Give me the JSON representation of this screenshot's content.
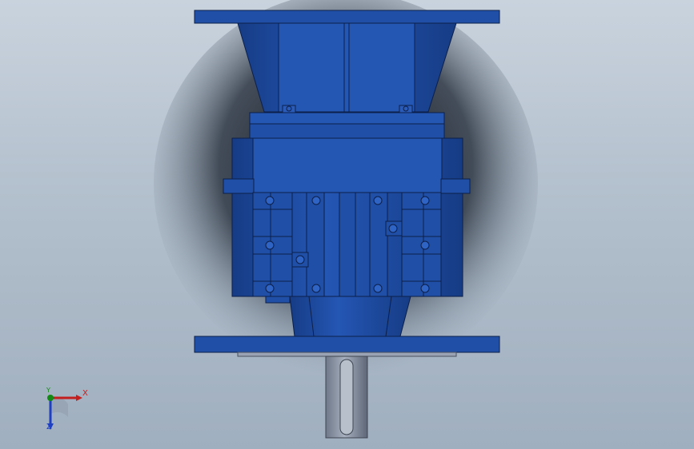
{
  "viewport": {
    "background_top": "#c9d3de",
    "background_bottom": "#a0afbf"
  },
  "model": {
    "body_color": "#1f4fa6",
    "body_shade": "#163c85",
    "body_light": "#2f63c4",
    "shaft_color": "#9aa3b3"
  },
  "triad": {
    "x_label": "X",
    "y_label": "Y",
    "z_label": "Z",
    "x_color": "#c41e1e",
    "y_color": "#138a13",
    "z_color": "#1e3fc4"
  }
}
